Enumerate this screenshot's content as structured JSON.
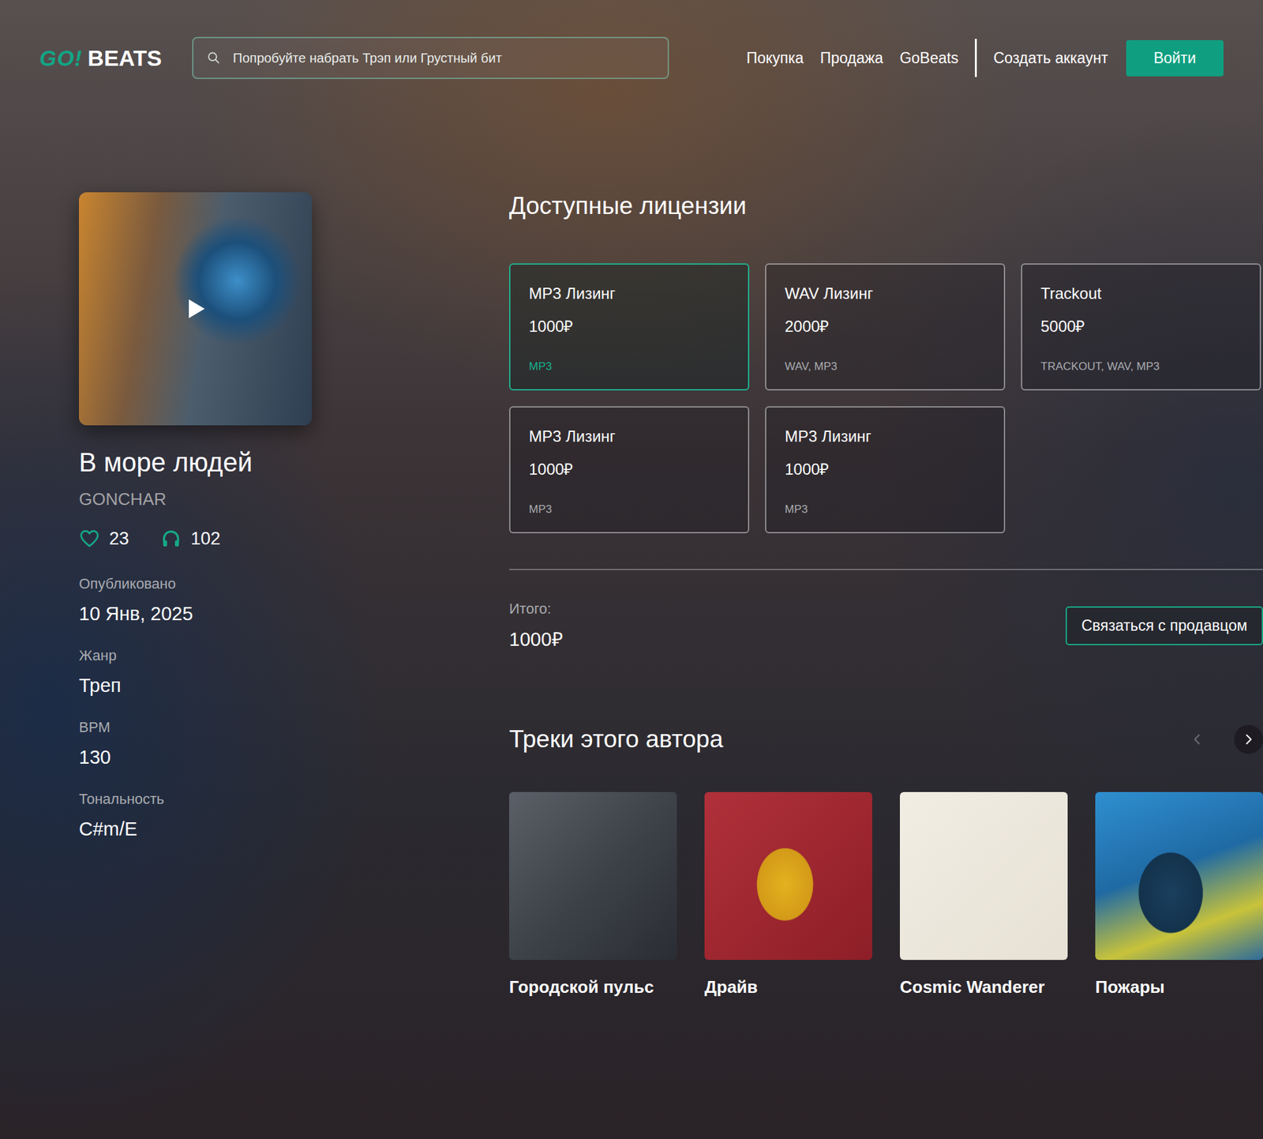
{
  "header": {
    "logo": {
      "mark": "GO!",
      "word": "BEATS"
    },
    "search": {
      "placeholder": "Попробуйте набрать Трэп или Грустный бит"
    },
    "nav": [
      {
        "label": "Покупка"
      },
      {
        "label": "Продажа"
      },
      {
        "label": "GoBeats"
      }
    ],
    "account_link": "Создать аккаунт",
    "login_button": "Войти"
  },
  "beat": {
    "title": "В море людей",
    "artist": "GONCHAR",
    "likes": "23",
    "plays": "102",
    "details": [
      {
        "label": "Опубликовано",
        "value": "10 Янв, 2025"
      },
      {
        "label": "Жанр",
        "value": "Треп"
      },
      {
        "label": "BPM",
        "value": "130"
      },
      {
        "label": "Тональность",
        "value": "C#m/E"
      }
    ]
  },
  "licenses": {
    "title": "Доступные лицензии",
    "items": [
      {
        "name": "MP3 Лизинг",
        "price": "1000₽",
        "formats": "MP3",
        "selected": true
      },
      {
        "name": "WAV Лизинг",
        "price": "2000₽",
        "formats": "WAV, MP3",
        "selected": false
      },
      {
        "name": "Trackout",
        "price": "5000₽",
        "formats": "TRACKOUT, WAV, MP3",
        "selected": false
      },
      {
        "name": "MP3 Лизинг",
        "price": "1000₽",
        "formats": "MP3",
        "selected": false
      },
      {
        "name": "MP3 Лизинг",
        "price": "1000₽",
        "formats": "MP3",
        "selected": false
      }
    ]
  },
  "total": {
    "label": "Итого:",
    "amount": "1000₽",
    "contact_button": "Связаться с продавцом"
  },
  "author_tracks": {
    "title": "Треки этого автора",
    "prev": {
      "disabled": true
    },
    "next": {
      "disabled": false
    },
    "items": [
      {
        "title": "Городской пульс"
      },
      {
        "title": "Драйв"
      },
      {
        "title": "Cosmic Wanderer"
      },
      {
        "title": "Пожары"
      }
    ]
  }
}
